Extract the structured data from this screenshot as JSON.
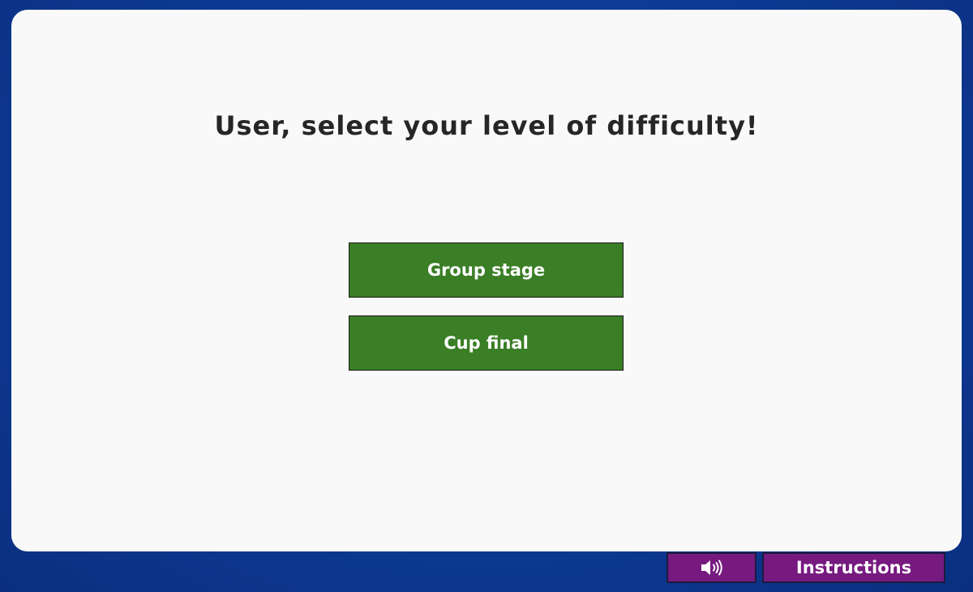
{
  "prompt": {
    "title": "User, select your level of difficulty!"
  },
  "levels": [
    {
      "label": "Group stage"
    },
    {
      "label": "Cup final"
    }
  ],
  "footer": {
    "sound_icon": "speaker-volume-icon",
    "instructions_label": "Instructions"
  },
  "colors": {
    "background": "#0d3a94",
    "panel": "#f9f9f9",
    "level_button": "#3a7e25",
    "footer_button": "#761a7f",
    "title_text": "#262626"
  }
}
